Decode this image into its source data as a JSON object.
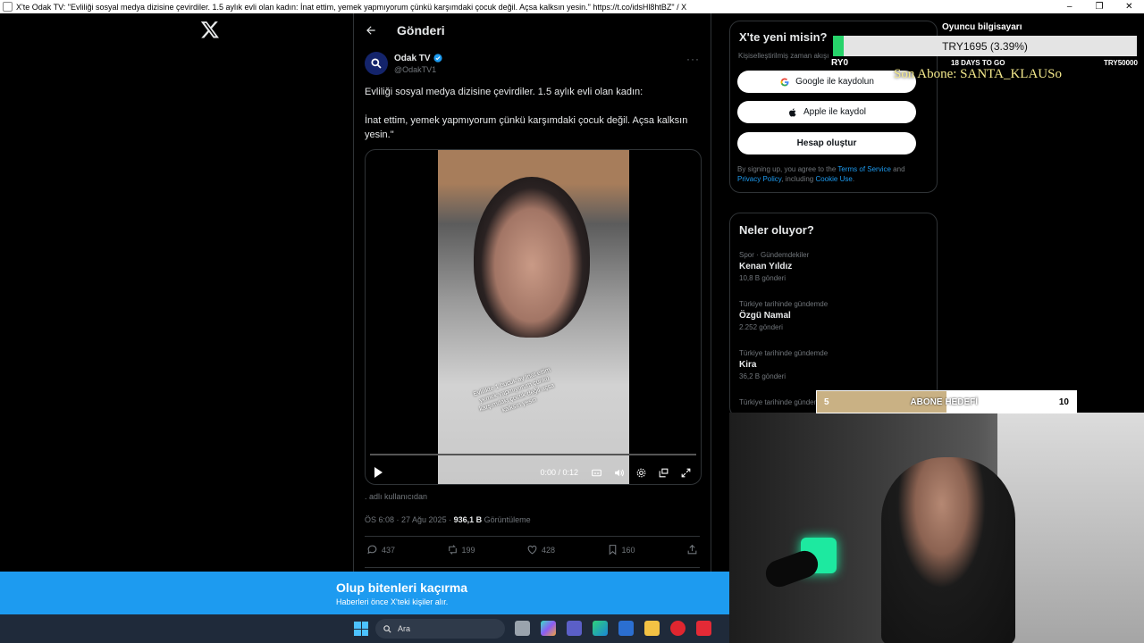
{
  "window": {
    "title": "X'te Odak TV: \"Evliliği sosyal medya dizisine çevirdiler. 1.5 aylık evli olan kadın: İnat ettim, yemek yapmıyorum çünkü karşımdaki çocuk değil. Açsa kalksın yesin.\" https://t.co/idsHl8htBZ\" / X"
  },
  "header": {
    "title": "Gönderi"
  },
  "post": {
    "author_name": "Odak TV",
    "author_handle": "@OdakTV1",
    "text_line1": "Evliliği sosyal medya dizisine çevirdiler. 1.5 aylık evli olan kadın:",
    "text_line2": "İnat ettim, yemek yapmıyorum çünkü karşımdaki çocuk değil.  Açsa kalksın yesin.\"",
    "video_caption": "Evlilikte 1 bucuk ay İnat ettim yemek yapmıyorum çünkü karşımdaki çocuk değil açsa kalksın yesin",
    "video_time": "0:00 / 0:12",
    "from_user": ". adlı kullanıcıdan",
    "timestamp": "ÖS 6:08 · 27 Ağu 2025 · ",
    "views_count": "936,1 B",
    "views_label": " Görüntüleme",
    "replies": "437",
    "reposts": "199",
    "likes": "428",
    "bookmarks": "160"
  },
  "signup": {
    "title": "X'te yeni misin?",
    "subtitle": "Kişiselleştirilmiş zaman akışı",
    "google_label": "Google ile kaydolun",
    "apple_label": "Apple ile kaydol",
    "create_label": "Hesap oluştur",
    "terms_pre": "By signing up, you agree to the ",
    "terms_link": "Terms of Service",
    "terms_and": " and ",
    "privacy_link": "Privacy Policy",
    "terms_including": ", including ",
    "cookie_link": "Cookie Use",
    "terms_end": "."
  },
  "trends": {
    "title": "Neler oluyor?",
    "items": [
      {
        "category": "Spor · Gündemdekiler",
        "name": "Kenan Yıldız",
        "count": "10,8 B gönderi"
      },
      {
        "category": "Türkiye tarihinde gündemde",
        "name": "Özgü Namal",
        "count": "2.252 gönderi"
      },
      {
        "category": "Türkiye tarihinde gündemde",
        "name": "Kira",
        "count": "36,2 B gönderi"
      },
      {
        "category": "Türkiye tarihinde gündemde",
        "name": "",
        "count": ""
      }
    ]
  },
  "overlay": {
    "player_label": "Oyuncu bilgisayarı",
    "donation_text": "TRY1695 (3.39%)",
    "donation_progress": 0.034,
    "left_label": "RY0",
    "days_label": "18 DAYS TO GO",
    "right_label": "TRY50000",
    "sub_text": "Son Abone: SANTA_KLAUSo",
    "goal_min": "5",
    "goal_label": "ABONE HEDEFİ",
    "goal_max": "10",
    "goal_progress": 0.5
  },
  "banner": {
    "title": "Olup bitenleri kaçırma",
    "subtitle": "Haberleri önce X'teki kişiler alır."
  },
  "taskbar": {
    "search_placeholder": "Ara"
  },
  "colors": {
    "accent": "#1d9bf0",
    "background": "#000000",
    "overlay_green": "#27d36a",
    "goal_fill": "#c9b184"
  }
}
